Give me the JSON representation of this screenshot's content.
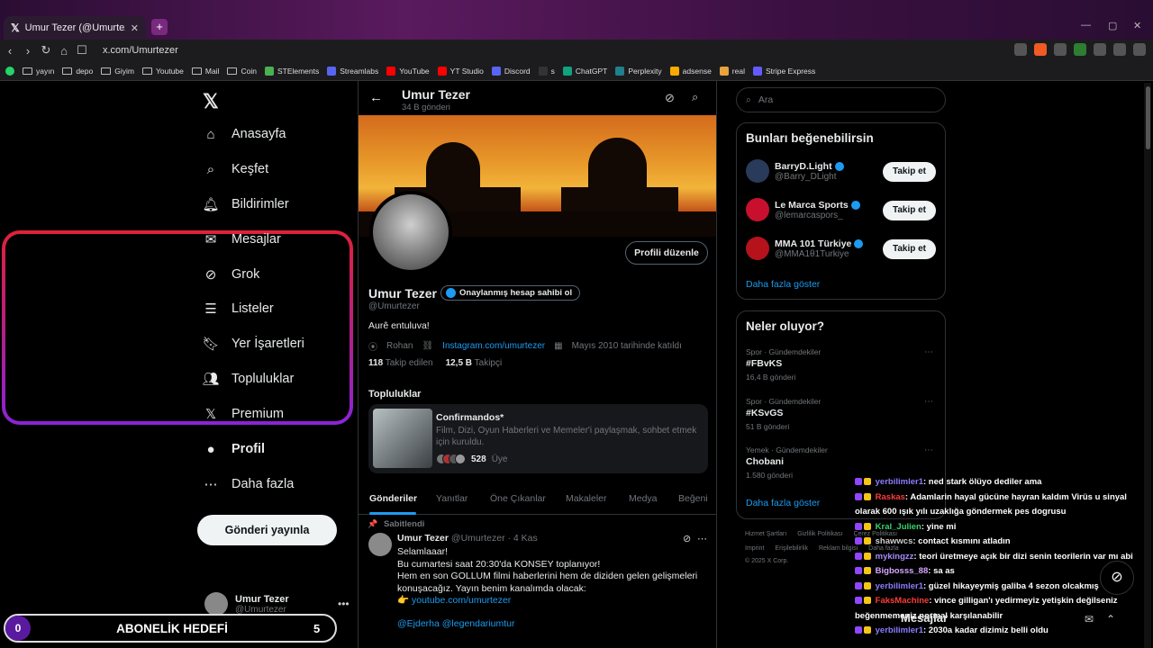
{
  "browser": {
    "tab_title": "Umur Tezer (@Umurtezer) / X",
    "url": "x.com/Umurtezer",
    "new_tab": "+",
    "bookmarks": [
      "yayın",
      "depo",
      "Giyim",
      "Youtube",
      "Mail",
      "Coin",
      "STElements",
      "Streamlabs",
      "YouTube",
      "YT Studio",
      "Discord",
      "s",
      "ChatGPT",
      "Perplexity",
      "adsense",
      "real",
      "Stripe Express"
    ]
  },
  "nav": {
    "logo": "X",
    "items": [
      {
        "label": "Anasayfa",
        "icon": "home-icon"
      },
      {
        "label": "Keşfet",
        "icon": "search-icon"
      },
      {
        "label": "Bildirimler",
        "icon": "bell-icon"
      },
      {
        "label": "Mesajlar",
        "icon": "mail-icon"
      },
      {
        "label": "Grok",
        "icon": "grok-icon"
      },
      {
        "label": "Listeler",
        "icon": "list-icon"
      },
      {
        "label": "Yer İşaretleri",
        "icon": "bookmark-icon"
      },
      {
        "label": "Topluluklar",
        "icon": "communities-icon"
      },
      {
        "label": "Premium",
        "icon": "x-icon"
      },
      {
        "label": "Profil",
        "icon": "profile-icon"
      },
      {
        "label": "Daha fazla",
        "icon": "more-circle-icon"
      }
    ],
    "post_button": "Gönderi yayınla",
    "account_name": "Umur Tezer",
    "account_handle": "@Umurtezer"
  },
  "sub_goal": {
    "current": "0",
    "label": "ABONELİK HEDEFİ",
    "target": "5"
  },
  "profile": {
    "header_name": "Umur Tezer",
    "header_posts": "34 B gönderi",
    "edit_button": "Profili düzenle",
    "name": "Umur Tezer",
    "verify_pill": "Onaylanmış hesap sahibi ol",
    "handle": "@Umurtezer",
    "bio": "Aurê entuluva!",
    "location": "Rohan",
    "link": "Instagram.com/umurtezer",
    "joined": "Mayıs 2010 tarihinde katıldı",
    "following_count": "118",
    "following_label": "Takip edilen",
    "followers_count": "12,5 B",
    "followers_label": "Takipçi",
    "communities_title": "Topluluklar",
    "community": {
      "name": "Confirmandos*",
      "desc": "Film, Dizi, Oyun Haberleri ve Memeler'i paylaşmak, sohbet etmek için kuruldu.",
      "members": "528",
      "members_label": "Üye"
    },
    "tabs": [
      "Gönderiler",
      "Yanıtlar",
      "Öne Çıkanlar",
      "Makaleler",
      "Medya",
      "Beğeni"
    ],
    "pinned_label": "Sabitlendi",
    "tweet": {
      "name": "Umur Tezer",
      "handle": "@Umurtezer · 4 Kas",
      "line1": "Selamlaaar!",
      "line2": "Bu cumartesi saat 20:30'da KONSEY toplanıyor!",
      "line3": "Hem en son GOLLUM filmi haberlerini hem de diziden gelen gelişmeleri konuşacağız. Yayın benim kanalımda olacak:",
      "emoji": "👉",
      "link": "youtube.com/umurtezer",
      "mentions": "@Ejderha @legendariumtur"
    }
  },
  "right": {
    "search_placeholder": "Ara",
    "suggest_title": "Bunları beğenebilirsin",
    "suggestions": [
      {
        "name": "BarryD.Light",
        "handle": "@Barry_DLight",
        "button": "Takip et",
        "color": "#2a3a5a"
      },
      {
        "name": "Le Marca Sports",
        "handle": "@lemarcaspors_",
        "button": "Takip et",
        "color": "#c8102e"
      },
      {
        "name": "MMA 101 Türkiye",
        "handle": "@MMA1θ1Turkiye",
        "button": "Takip et",
        "color": "#b5121b"
      }
    ],
    "show_more": "Daha fazla göster",
    "trends_title": "Neler oluyor?",
    "trends": [
      {
        "cat": "Spor · Gündemdekiler",
        "name": "#FBvKS",
        "count": "16,4 B gönderi"
      },
      {
        "cat": "Spor · Gündemdekiler",
        "name": "#KSvGS",
        "count": "51 B gönderi"
      },
      {
        "cat": "Yemek · Gündemdekiler",
        "name": "Chobani",
        "count": "1.580 gönderi"
      }
    ],
    "trends_more": "Daha fazla göster",
    "footer1": [
      "Hizmet Şartları",
      "Gizlilik Politikası",
      "Çerez Politikası"
    ],
    "footer2": [
      "Imprint",
      "Erişilebilirlik",
      "Reklam bilgisi",
      "Daha fazla"
    ],
    "copyright": "© 2025 X Corp."
  },
  "chat": [
    {
      "user": "yerbilimler1",
      "color": "#8a7cff",
      "text": ": ned stark ölüyo dediler ama"
    },
    {
      "user": "Raskas",
      "color": "#ff3b3b",
      "text": ": Adamlarin hayal gücüne hayran kaldım Virüs u sinyal olarak 600 ışık yılı uzaklığa göndermek pes dogrusu"
    },
    {
      "user": "Kral_Julien",
      "color": "#3bd16f",
      "text": ": yine mi"
    },
    {
      "user": "shawwcs",
      "color": "#cfcfcf",
      "text": ": contact kısmını atladın"
    },
    {
      "user": "mykingzz",
      "color": "#a78bfa",
      "text": ": teori üretmeye açık bir dizi senin teorilerin var mı abi"
    },
    {
      "user": "Bigbosss_88",
      "color": "#d7a6ff",
      "text": ": sa as"
    },
    {
      "user": "yerbilimler1",
      "color": "#8a7cff",
      "text": ": güzel hikayeymiş galiba 4 sezon olcakmış"
    },
    {
      "user": "FaksMachine",
      "color": "#ff3b3b",
      "text": ": vince gilligan'ı yedirmeyiz yetişkin değilseniz beğenmemeniz normal karşılanabilir"
    },
    {
      "user": "yerbilimler1",
      "color": "#8a7cff",
      "text": ": 2030a kadar dizimiz belli oldu"
    }
  ],
  "messages_bar": "Mesajlar"
}
